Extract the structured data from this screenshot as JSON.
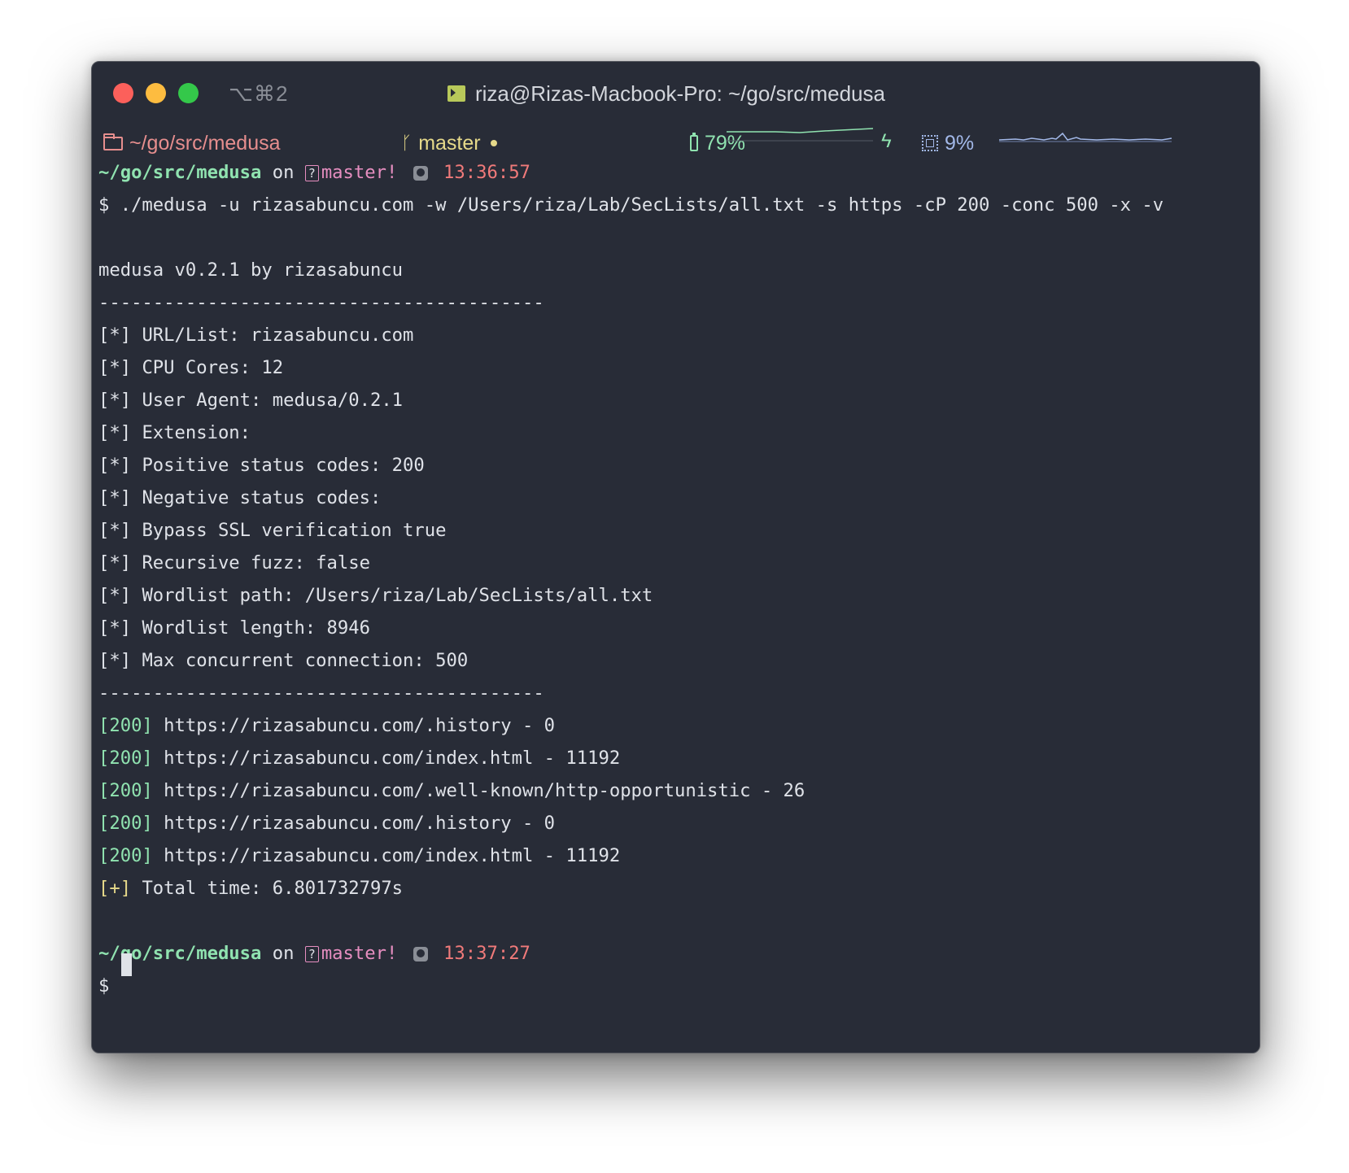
{
  "window": {
    "shortcut": "⌥⌘2",
    "title": "riza@Rizas-Macbook-Pro: ~/go/src/medusa"
  },
  "statusbar": {
    "path": "~/go/src/medusa",
    "branch": "master",
    "battery": "79%",
    "cpu": "9%"
  },
  "prompts": [
    {
      "path": "~/go/src/medusa",
      "on": "on",
      "branch": "master!",
      "time": "13:36:57"
    },
    {
      "path": "~/go/src/medusa",
      "on": "on",
      "branch": "master!",
      "time": "13:37:27"
    }
  ],
  "command": "$ ./medusa -u rizasabuncu.com -w /Users/riza/Lab/SecLists/all.txt -s https -cP 200 -conc 500 -x -v",
  "banner": "medusa v0.2.1 by rizasabuncu",
  "separator": "-----------------------------------------",
  "info_prefix": "[*]",
  "info_lines": [
    "URL/List: rizasabuncu.com",
    "CPU Cores: 12",
    "User Agent: medusa/0.2.1",
    "Extension:",
    "Positive status codes: 200",
    "Negative status codes:",
    "Bypass SSL verification true",
    "Recursive fuzz: false",
    "Wordlist path: /Users/riza/Lab/SecLists/all.txt",
    "Wordlist length: 8946",
    "Max concurrent connection: 500"
  ],
  "results": [
    {
      "code": "[200]",
      "text": "https://rizasabuncu.com/.history - 0"
    },
    {
      "code": "[200]",
      "text": "https://rizasabuncu.com/index.html - 11192"
    },
    {
      "code": "[200]",
      "text": "https://rizasabuncu.com/.well-known/http-opportunistic - 26"
    },
    {
      "code": "[200]",
      "text": "https://rizasabuncu.com/.history - 0"
    },
    {
      "code": "[200]",
      "text": "https://rizasabuncu.com/index.html - 11192"
    }
  ],
  "total": {
    "prefix": "[+]",
    "text": "Total time: 6.801732797s"
  },
  "final_prompt": "$",
  "colors": {
    "background": "#282c37",
    "text": "#dfe2e8",
    "path_green": "#90e3b0",
    "branch_pink": "#e68ec0",
    "time_red": "#f07a7a",
    "yellow": "#e6d98a",
    "cpu_blue": "#a2b8e8"
  }
}
